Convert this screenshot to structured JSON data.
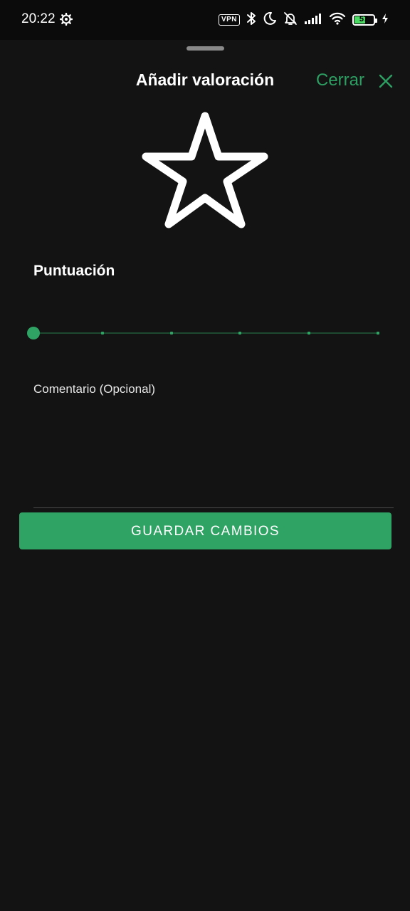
{
  "status_bar": {
    "time": "20:22",
    "vpn_label": "VPN",
    "battery_level": "57",
    "icons": [
      "settings-gear-icon",
      "vpn-icon",
      "bluetooth-icon",
      "moon-icon",
      "bell-off-icon",
      "signal-icon",
      "wifi-icon",
      "battery-icon",
      "charging-bolt-icon"
    ]
  },
  "sheet": {
    "title": "Añadir valoración",
    "close_label": "Cerrar",
    "close_icon": "close-icon",
    "header_icon": "star-outline-icon"
  },
  "rating": {
    "label": "Puntuación",
    "value": 0,
    "min": 0,
    "max": 5,
    "steps": [
      0,
      1,
      2,
      3,
      4,
      5
    ]
  },
  "comment": {
    "label": "Comentario (Opcional)",
    "value": ""
  },
  "actions": {
    "save_label": "GUARDAR CAMBIOS"
  },
  "colors": {
    "accent": "#2ea363",
    "background": "#131313",
    "status_bar": "#0b0b0b",
    "text": "#ffffff"
  }
}
